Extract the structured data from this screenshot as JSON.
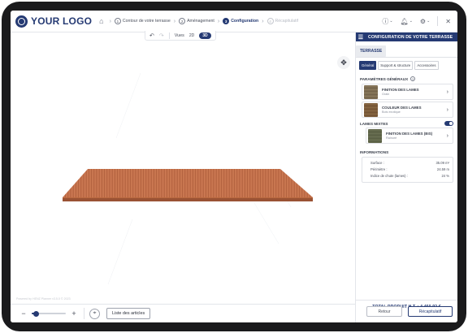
{
  "header": {
    "logo_text": "YOUR LOGO",
    "steps": [
      {
        "num": "1",
        "label": "Contour de votre terrasse"
      },
      {
        "num": "2",
        "label": "Aménagement"
      },
      {
        "num": "3",
        "label": "Configuration"
      },
      {
        "num": "4",
        "label": "Récapitulatif"
      }
    ],
    "active_step": "Configuration"
  },
  "toolbar": {
    "view_label": "Vues",
    "view_2d": "2D",
    "view_3d": "3D"
  },
  "canvas": {
    "watermark": "Powered by HENZ Planner v3.5.0 © 2023"
  },
  "bottom": {
    "zoom_minus": "−",
    "zoom_plus": "+",
    "zoom_level": 0.12,
    "list_button": "Liste des articles"
  },
  "panel": {
    "title": "CONFIGURATION DE VOTRE TERRASSE",
    "tab": "TERRASSE",
    "subtabs": [
      "Général",
      "Support & structure",
      "Accessoires"
    ],
    "general_title": "PARAMÈTRES GÉNÉRAUX",
    "cards": [
      {
        "title": "FINITION DES LAMES",
        "sub": "Grain"
      },
      {
        "title": "COULEUR DES LAMES",
        "sub": "Bois exotique"
      }
    ],
    "mixed_title": "LAMES MIXTES",
    "mixed_enabled": true,
    "mixed_card": {
      "title": "FINITION DES LAMES (BIS)",
      "sub": "Rainuré"
    },
    "info_title": "INFORMATIONS",
    "info_rows": [
      {
        "label": "Surface :",
        "value": "35.09 m²"
      },
      {
        "label": "Périmètre :",
        "value": "24.59 m"
      },
      {
        "label": "Indice de chute (lames) :",
        "value": "24 %"
      }
    ],
    "total": "TOTAL PRODUIT H.T. : 4 460,92 €"
  },
  "actions": {
    "back": "Retour",
    "summary": "Récapitulatif"
  },
  "colors": {
    "brand": "#253a73",
    "deck": "#c8744e"
  }
}
